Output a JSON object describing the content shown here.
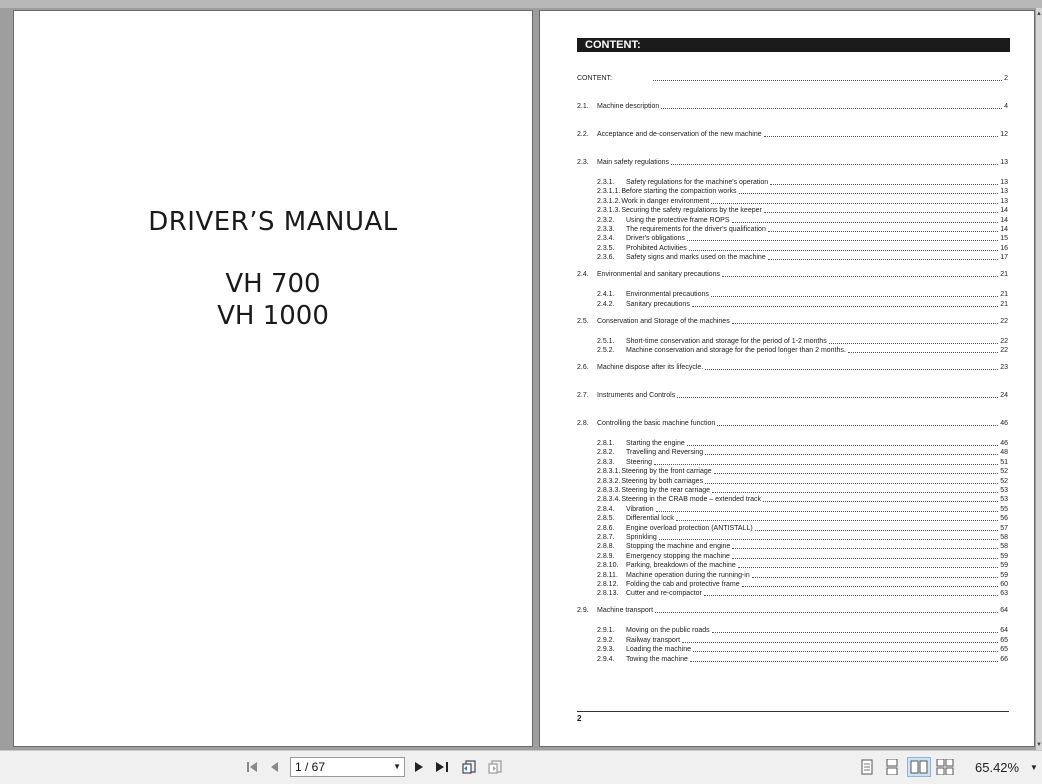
{
  "cover": {
    "title": "DRIVER’S MANUAL",
    "model_1": "VH 700",
    "model_2": "VH 1000"
  },
  "content_page": {
    "heading": "CONTENT:",
    "footer_page": "2",
    "entries": [
      {
        "kind": "header",
        "num": "",
        "title": "CONTENT:",
        "page": "2"
      },
      {
        "kind": "main",
        "num": "2.1.",
        "title": "Machine description",
        "page": "4"
      },
      {
        "kind": "main",
        "num": "2.2.",
        "title": "Acceptance and de-conservation of the new machine",
        "page": "12"
      },
      {
        "kind": "main",
        "num": "2.3.",
        "title": "Main safety regulations",
        "page": "13"
      },
      {
        "kind": "sub",
        "num": "2.3.1.",
        "title": "Safety regulations for the machine's operation",
        "page": "13"
      },
      {
        "kind": "subsub",
        "num": "2.3.1.1.",
        "title": "Before starting the compaction works",
        "page": "13"
      },
      {
        "kind": "subsub",
        "num": "2.3.1.2.",
        "title": "Work in danger environment",
        "page": "13"
      },
      {
        "kind": "subsub",
        "num": "2.3.1.3.",
        "title": "Securing the safety regulations by the keeper",
        "page": "14"
      },
      {
        "kind": "sub",
        "num": "2.3.2.",
        "title": "Using the protective frame ROPS",
        "page": "14"
      },
      {
        "kind": "sub",
        "num": "2.3.3.",
        "title": "The requirements for the driver's qualification",
        "page": "14"
      },
      {
        "kind": "sub",
        "num": "2.3.4.",
        "title": "Driver's obligations",
        "page": "15"
      },
      {
        "kind": "sub",
        "num": "2.3.5.",
        "title": "Prohibited Activities",
        "page": "16"
      },
      {
        "kind": "sub",
        "num": "2.3.6.",
        "title": "Safety signs and marks used on the machine",
        "page": "17"
      },
      {
        "kind": "main",
        "num": "2.4.",
        "title": "Environmental and sanitary precautions",
        "page": "21"
      },
      {
        "kind": "sub",
        "num": "2.4.1.",
        "title": "Environmental precautions",
        "page": "21"
      },
      {
        "kind": "sub",
        "num": "2.4.2.",
        "title": "Sanitary precautions",
        "page": "21"
      },
      {
        "kind": "main",
        "num": "2.5.",
        "title": "Conservation and Storage of the machines",
        "page": "22"
      },
      {
        "kind": "sub",
        "num": "2.5.1.",
        "title": "Short-time conservation and storage for the period of 1-2 months",
        "page": "22"
      },
      {
        "kind": "sub",
        "num": "2.5.2.",
        "title": "Machine conservation and storage for the period longer than 2 months.",
        "page": "22"
      },
      {
        "kind": "main",
        "num": "2.6.",
        "title": "Machine dispose after its lifecycle.",
        "page": "23"
      },
      {
        "kind": "main",
        "num": "2.7.",
        "title": "Instruments and Controls",
        "page": "24"
      },
      {
        "kind": "main",
        "num": "2.8.",
        "title": "Controlling the basic machine function",
        "page": "46"
      },
      {
        "kind": "sub",
        "num": "2.8.1.",
        "title": "Starting the engine",
        "page": "46"
      },
      {
        "kind": "sub",
        "num": "2.8.2.",
        "title": "Travelling and Reversing",
        "page": "48"
      },
      {
        "kind": "sub",
        "num": "2.8.3.",
        "title": "Steering",
        "page": "51"
      },
      {
        "kind": "subsub",
        "num": "2.8.3.1.",
        "title": "Steering by the front carriage",
        "page": "52"
      },
      {
        "kind": "subsub",
        "num": "2.8.3.2.",
        "title": "Steering by both carriages",
        "page": "52"
      },
      {
        "kind": "subsub",
        "num": "2.8.3.3.",
        "title": "Steering by the rear carriage",
        "page": "53"
      },
      {
        "kind": "subsub",
        "num": "2.8.3.4.",
        "title": "Steering in the CRAB mode – extended track",
        "page": "53"
      },
      {
        "kind": "sub",
        "num": "2.8.4.",
        "title": "Vibration",
        "page": "55"
      },
      {
        "kind": "sub",
        "num": "2.8.5.",
        "title": "Differential lock",
        "page": "56"
      },
      {
        "kind": "sub",
        "num": "2.8.6.",
        "title": "Engine overload protection (ANTISTALL)",
        "page": "57"
      },
      {
        "kind": "sub",
        "num": "2.8.7.",
        "title": "Sprinkling",
        "page": "58"
      },
      {
        "kind": "sub",
        "num": "2.8.8.",
        "title": "Stopping the machine and engine",
        "page": "58"
      },
      {
        "kind": "sub",
        "num": "2.8.9.",
        "title": "Emergency stopping the machine",
        "page": "59"
      },
      {
        "kind": "sub",
        "num": "2.8.10.",
        "title": "Parking, breakdown of the machine",
        "page": "59"
      },
      {
        "kind": "sub",
        "num": "2.8.11.",
        "title": "Machine operation during the running-in",
        "page": "59"
      },
      {
        "kind": "sub",
        "num": "2.8.12.",
        "title": "Folding the cab and protective frame",
        "page": "60"
      },
      {
        "kind": "sub",
        "num": "2.8.13.",
        "title": "Cutter and re-compactor",
        "page": "63"
      },
      {
        "kind": "main",
        "num": "2.9.",
        "title": "Machine transport",
        "page": "64"
      },
      {
        "kind": "sub",
        "num": "2.9.1.",
        "title": "Moving on the public roads",
        "page": "64"
      },
      {
        "kind": "sub",
        "num": "2.9.2.",
        "title": "Railway transport",
        "page": "65"
      },
      {
        "kind": "sub",
        "num": "2.9.3.",
        "title": "Loading the machine",
        "page": "65"
      },
      {
        "kind": "sub",
        "num": "2.9.4.",
        "title": "Towing the machine",
        "page": "66"
      }
    ]
  },
  "toolbar": {
    "page_value": "1 / 67",
    "zoom": "65.42%"
  },
  "icons": {
    "first": "first-page-icon",
    "prev": "previous-page-icon",
    "next": "next-page-icon",
    "last": "last-page-icon"
  }
}
